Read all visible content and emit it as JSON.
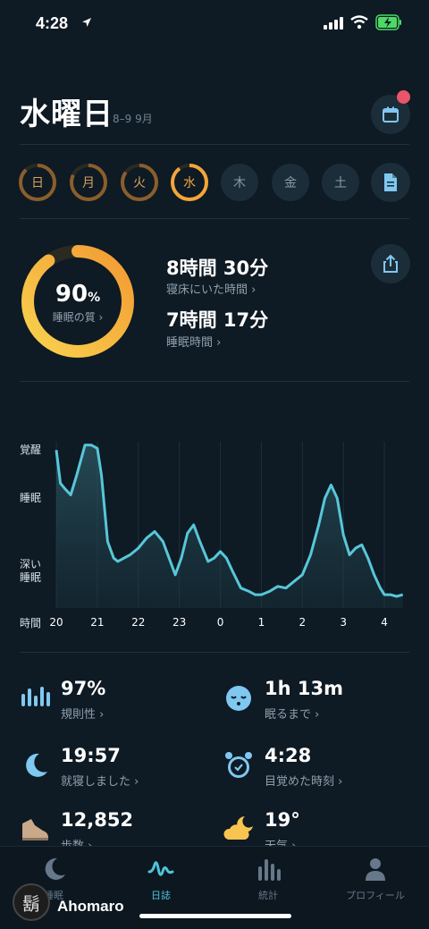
{
  "status_bar": {
    "time": "4:28"
  },
  "header": {
    "title": "水曜日",
    "date_range": "8–9 9月"
  },
  "week": [
    {
      "label": "日",
      "progress": 0.88,
      "active": false
    },
    {
      "label": "月",
      "progress": 0.82,
      "active": false
    },
    {
      "label": "火",
      "progress": 0.85,
      "active": false
    },
    {
      "label": "水",
      "progress": 0.9,
      "active": true
    },
    {
      "label": "木",
      "progress": 0,
      "active": false
    },
    {
      "label": "金",
      "progress": 0,
      "active": false
    },
    {
      "label": "土",
      "progress": 0,
      "active": false
    }
  ],
  "summary": {
    "quality_value": "90",
    "quality_unit": "%",
    "quality_label": "睡眠の質 ›",
    "quality_fraction": 0.9,
    "time_in_bed": "8時間 30分",
    "time_in_bed_label": "寝床にいた時間 ›",
    "sleep_time": "7時間 17分",
    "sleep_time_label": "睡眠時間 ›"
  },
  "chart_data": {
    "type": "area",
    "y_labels": [
      "覚醒",
      "睡眠",
      "深い\n睡眠"
    ],
    "x_axis_label": "時間",
    "x_ticks": [
      "20",
      "21",
      "22",
      "23",
      "0",
      "1",
      "2",
      "3",
      "4"
    ],
    "x": [
      20.0,
      20.1,
      20.2,
      20.35,
      20.5,
      20.7,
      20.85,
      21.0,
      21.1,
      21.25,
      21.4,
      21.5,
      21.65,
      21.8,
      22.0,
      22.2,
      22.4,
      22.6,
      22.75,
      22.9,
      23.05,
      23.2,
      23.35,
      23.5,
      23.7,
      23.85,
      24.0,
      24.15,
      24.3,
      24.5,
      24.7,
      24.85,
      25.0,
      25.2,
      25.4,
      25.6,
      25.8,
      26.0,
      26.2,
      26.4,
      26.55,
      26.7,
      26.85,
      27.0,
      27.15,
      27.3,
      27.45,
      27.6,
      27.75,
      27.9,
      28.0,
      28.15,
      28.3,
      28.45
    ],
    "y": [
      0.95,
      0.75,
      0.72,
      0.68,
      0.8,
      0.98,
      0.98,
      0.96,
      0.8,
      0.4,
      0.3,
      0.28,
      0.3,
      0.32,
      0.36,
      0.42,
      0.46,
      0.4,
      0.3,
      0.2,
      0.3,
      0.45,
      0.5,
      0.4,
      0.28,
      0.3,
      0.34,
      0.3,
      0.22,
      0.12,
      0.1,
      0.08,
      0.08,
      0.1,
      0.13,
      0.12,
      0.16,
      0.2,
      0.32,
      0.5,
      0.66,
      0.74,
      0.66,
      0.44,
      0.32,
      0.36,
      0.38,
      0.3,
      0.2,
      0.12,
      0.08,
      0.08,
      0.07,
      0.08
    ],
    "ylim": [
      0,
      1
    ],
    "xlim": [
      20,
      28.5
    ]
  },
  "metrics": [
    {
      "value": "97%",
      "label": "規則性 ›",
      "icon": "bars-icon"
    },
    {
      "value": "1h 13m",
      "label": "眠るまで ›",
      "icon": "sleepy-face-icon"
    },
    {
      "value": "19:57",
      "label": "就寝しました ›",
      "icon": "moon-icon"
    },
    {
      "value": "4:28",
      "label": "目覚めた時刻 ›",
      "icon": "alarm-clock-icon"
    },
    {
      "value": "12,852",
      "label": "歩数 ›",
      "icon": "shoe-icon"
    },
    {
      "value": "19°",
      "label": "天気 ›",
      "icon": "cloud-moon-icon"
    }
  ],
  "tabs": [
    {
      "label": "睡眠",
      "icon": "moon-icon",
      "active": false
    },
    {
      "label": "日誌",
      "icon": "wave-icon",
      "active": true
    },
    {
      "label": "統計",
      "icon": "stats-icon",
      "active": false
    },
    {
      "label": "プロフィール",
      "icon": "person-icon",
      "active": false
    }
  ],
  "watermark": {
    "glyph": "鬍",
    "name": "Ahomaro"
  },
  "colors": {
    "background": "#0e1a24",
    "accent_orange": "#f3a53a",
    "accent_yellow": "#f8d24e",
    "chart_line": "#57c7d8",
    "icon_blue": "#7fc8f0",
    "icon_yellow": "#f7c44f"
  }
}
